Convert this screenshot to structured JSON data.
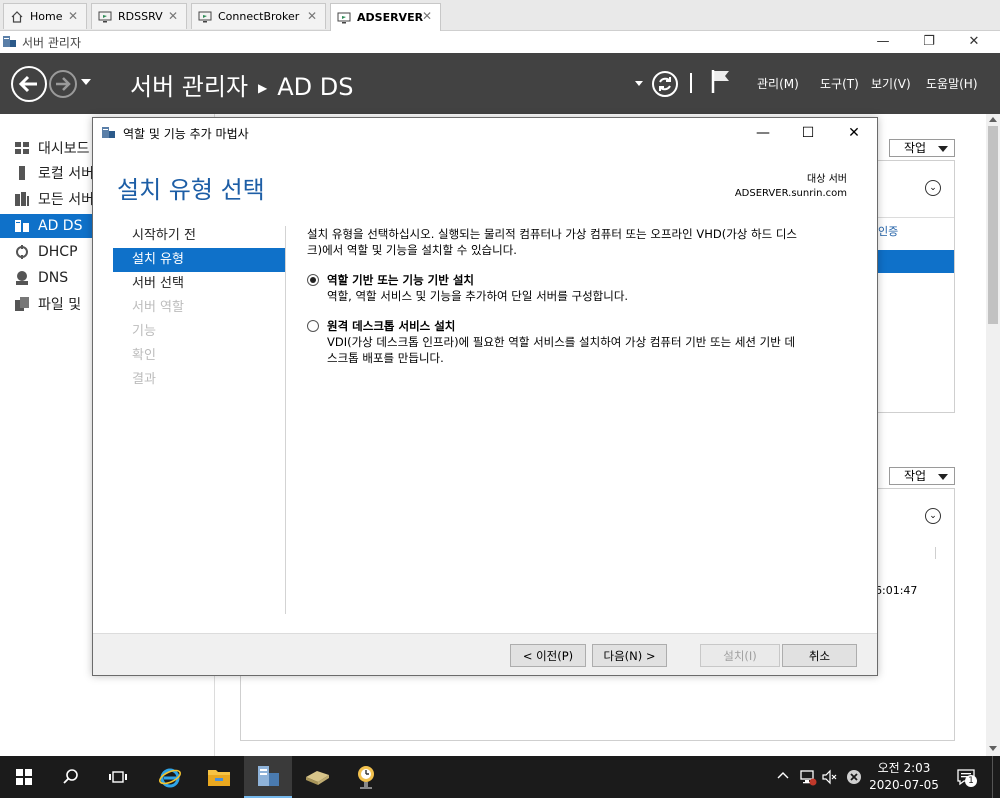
{
  "tabs": [
    {
      "label": "Home",
      "icon": "home-icon",
      "active": false
    },
    {
      "label": "RDSSRV",
      "icon": "remote-desktop-icon",
      "active": false
    },
    {
      "label": "ConnectBroker",
      "icon": "remote-desktop-icon",
      "active": false
    },
    {
      "label": "ADSERVER",
      "icon": "remote-desktop-icon",
      "active": true
    }
  ],
  "app": {
    "title": "서버 관리자",
    "window_buttons": {
      "minimize": "—",
      "restore": "❐",
      "close": "✕"
    }
  },
  "header": {
    "breadcrumb_root": "서버 관리자",
    "breadcrumb_sep": "▶",
    "breadcrumb_current": "AD DS",
    "menu": {
      "manage": "관리(M)",
      "tools": "도구(T)",
      "view": "보기(V)",
      "help": "도움말(H)"
    }
  },
  "sidebar": {
    "items": [
      {
        "label": "대시보드",
        "icon": "dashboard-icon"
      },
      {
        "label": "로컬 서버",
        "icon": "local-server-icon"
      },
      {
        "label": "모든 서버",
        "icon": "all-servers-icon"
      },
      {
        "label": "AD DS",
        "icon": "ad-ds-icon",
        "selected": true
      },
      {
        "label": "DHCP",
        "icon": "dhcp-icon"
      },
      {
        "label": "DNS",
        "icon": "dns-icon"
      },
      {
        "label": "파일 및",
        "icon": "file-services-icon"
      }
    ]
  },
  "background": {
    "task_label": "작업",
    "column_fragment": "인증",
    "time_fragment": "6:01:47"
  },
  "wizard": {
    "title": "역할 및 기능 추가 마법사",
    "heading": "설치 유형 선택",
    "target_label": "대상 서버",
    "target_server": "ADSERVER.sunrin.com",
    "steps": [
      {
        "label": "시작하기 전",
        "state": "normal"
      },
      {
        "label": "설치 유형",
        "state": "current"
      },
      {
        "label": "서버 선택",
        "state": "normal"
      },
      {
        "label": "서버 역할",
        "state": "disabled"
      },
      {
        "label": "기능",
        "state": "disabled"
      },
      {
        "label": "확인",
        "state": "disabled"
      },
      {
        "label": "결과",
        "state": "disabled"
      }
    ],
    "description_line1": "설치 유형을 선택하십시오. 실행되는 물리적 컴퓨터나 가상 컴퓨터 또는 오프라인 VHD(가상 하드 디스",
    "description_line2": "크)에서 역할 및 기능을 설치할 수 있습니다.",
    "options": [
      {
        "label": "역할 기반 또는 기능 기반 설치",
        "desc_line1": "역할, 역할 서비스 및 기능을 추가하여 단일 서버를 구성합니다.",
        "desc_line2": "",
        "checked": true
      },
      {
        "label": "원격 데스크톱 서비스 설치",
        "desc_line1": "VDI(가상 데스크톱 인프라)에 필요한 역할 서비스를 설치하여 가상 컴퓨터 기반 또는 세션 기반 데",
        "desc_line2": "스크톱 배포를 만듭니다.",
        "checked": false
      }
    ],
    "buttons": {
      "previous": "< 이전(P)",
      "next": "다음(N) >",
      "install": "설치(I)",
      "cancel": "취소"
    }
  },
  "taskbar": {
    "items": [
      "start-icon",
      "search-icon",
      "task-view-icon",
      "internet-explorer-icon",
      "file-explorer-icon",
      "server-manager-icon",
      "storage-icon",
      "clock-app-icon"
    ],
    "time": "오전 2:03",
    "date": "2020-07-05",
    "notification_count": "1"
  },
  "colors": {
    "accent": "#0f71c9",
    "header_bg": "#424242",
    "heading_blue": "#1d5ea6",
    "taskbar_bg": "#1b1b1b"
  }
}
